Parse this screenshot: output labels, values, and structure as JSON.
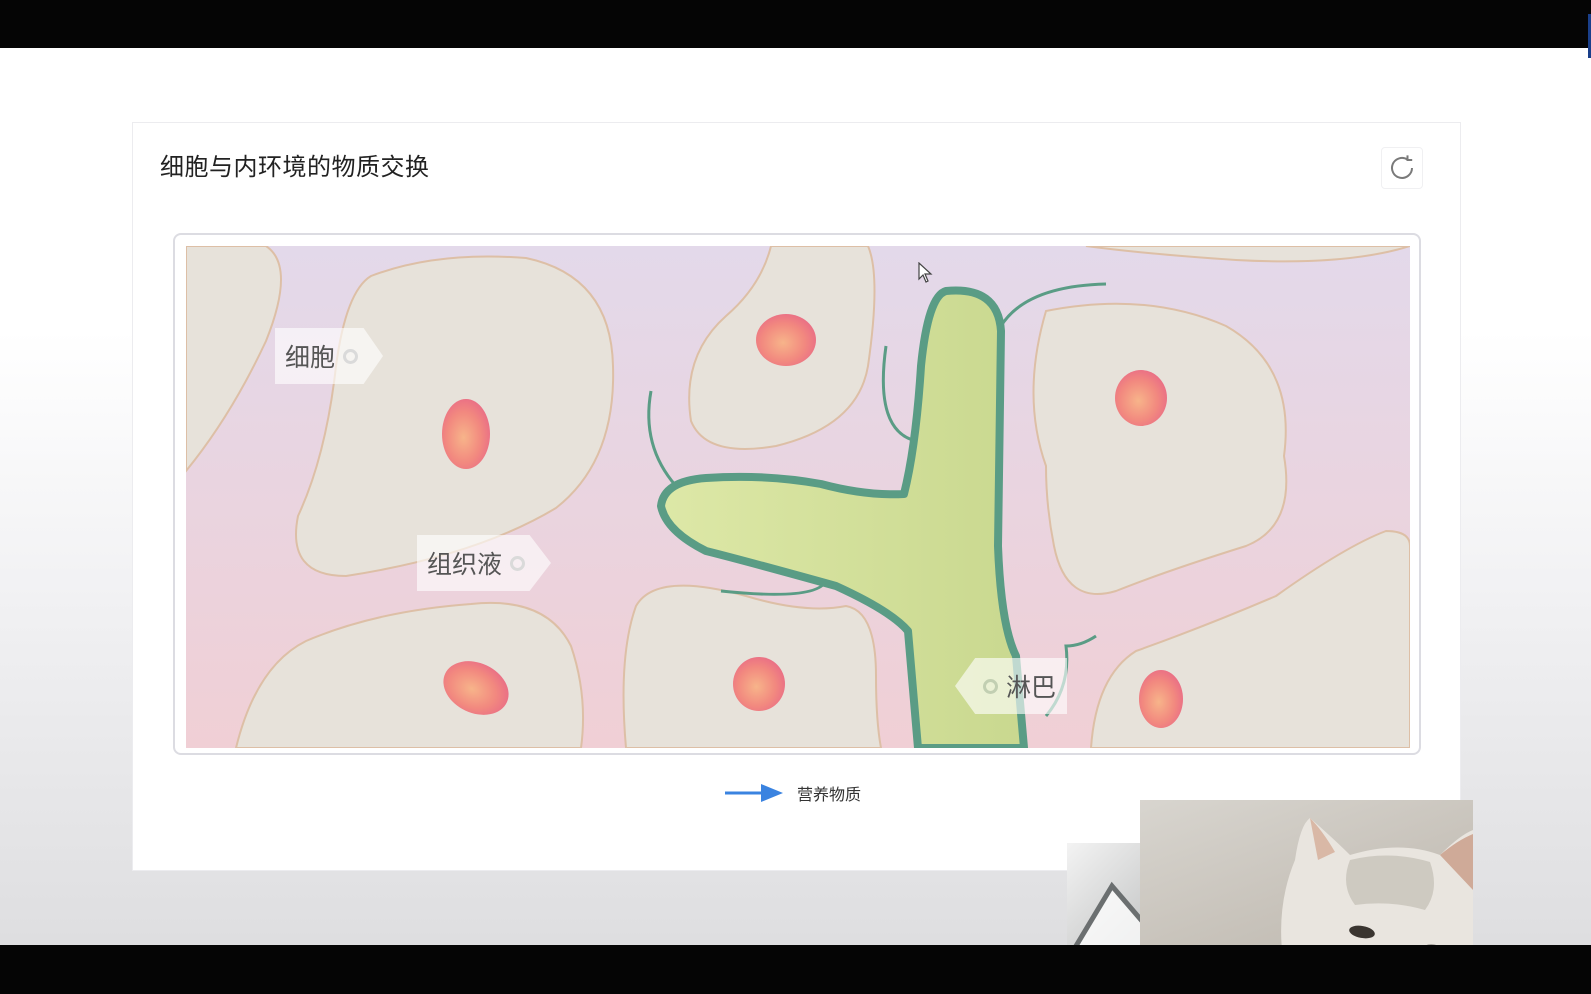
{
  "card": {
    "title": "细胞与内环境的物质交换",
    "refresh_icon": "refresh-icon"
  },
  "diagram": {
    "labels": {
      "cell": "细胞",
      "tissue_fluid": "组织液",
      "lymph": "淋巴"
    },
    "colors": {
      "background_top": "#e3d9ea",
      "background_bottom": "#f0cfd5",
      "cell_fill": "#e7e2da",
      "cell_outline": "#ddbfa6",
      "nucleus": "#f2897f",
      "lymph_vessel_fill": "#d4e09d",
      "lymph_vessel_wall": "#5a9c85"
    }
  },
  "legend": {
    "arrow_color": "#3a83e0",
    "label": "营养物质"
  },
  "webcam_overlay": {
    "subject": "cat"
  },
  "cursor_icon": "mouse-pointer-icon"
}
